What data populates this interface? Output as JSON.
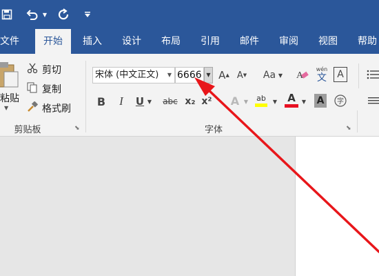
{
  "tabs": [
    {
      "label": "文件"
    },
    {
      "label": "开始"
    },
    {
      "label": "插入"
    },
    {
      "label": "设计"
    },
    {
      "label": "布局"
    },
    {
      "label": "引用"
    },
    {
      "label": "邮件"
    },
    {
      "label": "审阅"
    },
    {
      "label": "视图"
    },
    {
      "label": "帮助"
    }
  ],
  "clipboard": {
    "paste_label": "粘贴",
    "cut_label": "剪切",
    "copy_label": "复制",
    "format_painter_label": "格式刷",
    "group_label": "剪贴板"
  },
  "font": {
    "font_name": "宋体 (中文正文)",
    "font_size": "6666",
    "group_label": "字体",
    "bold": "B",
    "italic": "I",
    "underline": "U",
    "strikethrough": "abc",
    "subscript": "x₂",
    "superscript": "x²",
    "change_case": "Aa",
    "char_shading": "A",
    "font_color": "A",
    "text_effects": "A",
    "grow_font": "A",
    "shrink_font": "A",
    "phonetic_top": "wén",
    "phonetic_bottom": "文",
    "char_border": "A"
  },
  "colors": {
    "accent": "#2b579a",
    "highlight": "#ffff00",
    "font_color": "#e81123",
    "arrow": "#e8161a"
  }
}
